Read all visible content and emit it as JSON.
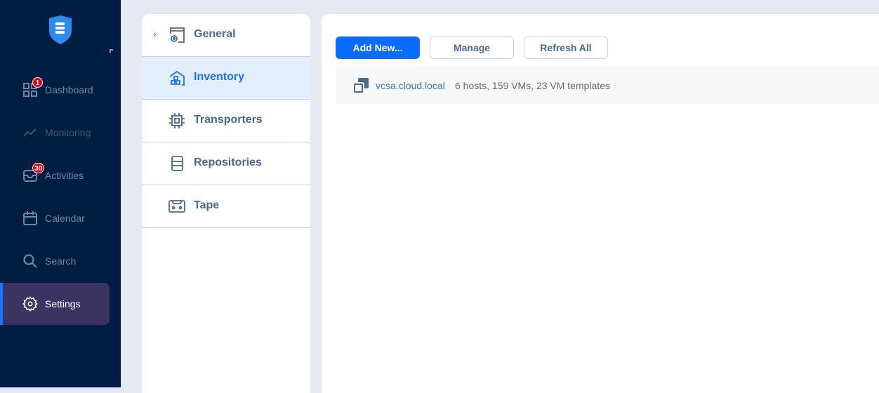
{
  "sidebar": {
    "items": [
      {
        "label": "Dashboard",
        "icon": "grid-icon",
        "badge": "1"
      },
      {
        "label": "Monitoring",
        "icon": "chart-line-icon"
      },
      {
        "label": "Activities",
        "icon": "inbox-icon",
        "badge": "30"
      },
      {
        "label": "Calendar",
        "icon": "calendar-icon"
      },
      {
        "label": "Search",
        "icon": "search-icon"
      },
      {
        "label": "Settings",
        "icon": "gear-icon",
        "active": true
      }
    ]
  },
  "settings_menu": {
    "items": [
      {
        "label": "General",
        "icon": "window-gear-icon"
      },
      {
        "label": "Inventory",
        "icon": "house-boxes-icon",
        "selected": true
      },
      {
        "label": "Transporters",
        "icon": "chip-icon"
      },
      {
        "label": "Repositories",
        "icon": "storage-icon"
      },
      {
        "label": "Tape",
        "icon": "tape-icon"
      }
    ]
  },
  "toolbar": {
    "add_new": "Add New...",
    "manage": "Manage",
    "refresh_all": "Refresh All"
  },
  "inventory": {
    "name": "vcsa.cloud.local",
    "info": "6 hosts, 159 VMs, 23 VM templates"
  },
  "colors": {
    "accent": "#0a6cff",
    "sidebar": "#001e42",
    "active": "#3b3463"
  }
}
